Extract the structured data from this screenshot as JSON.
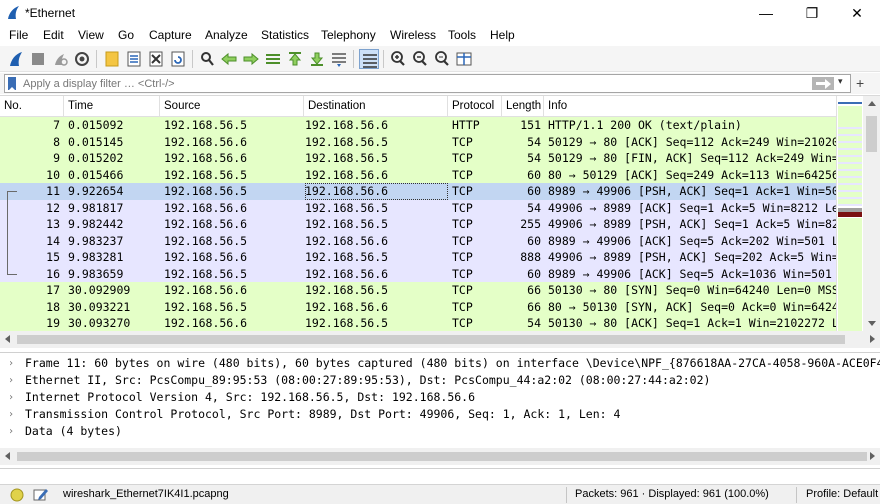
{
  "window": {
    "title": "*Ethernet",
    "minimize": "—",
    "maximize": "❐",
    "close": "✕"
  },
  "menu": [
    "File",
    "Edit",
    "View",
    "Go",
    "Capture",
    "Analyze",
    "Statistics",
    "Telephony",
    "Wireless",
    "Tools",
    "Help"
  ],
  "toolbar_icons": [
    "shark-fin-start-icon",
    "stop-icon",
    "restart-icon",
    "options-gear-icon",
    "open-file-icon",
    "save-file-icon",
    "close-file-icon",
    "reload-icon",
    "find-packet-icon",
    "go-back-icon",
    "go-forward-icon",
    "go-to-packet-icon",
    "go-first-icon",
    "go-last-icon",
    "autoscroll-icon",
    "colorize-icon",
    "zoom-in-icon",
    "zoom-out-icon",
    "zoom-normal-icon",
    "resize-columns-icon"
  ],
  "filter": {
    "placeholder": "Apply a display filter … <Ctrl-/>",
    "dropdown": "▾",
    "add": "+"
  },
  "columns": [
    "No.",
    "Time",
    "Source",
    "Destination",
    "Protocol",
    "Length",
    "Info"
  ],
  "packets": [
    {
      "no": "7",
      "time": "0.015092",
      "src": "192.168.56.5",
      "dst": "192.168.56.6",
      "proto": "HTTP",
      "len": "151",
      "info": "HTTP/1.1 200 OK  (text/plain)",
      "style": "http"
    },
    {
      "no": "8",
      "time": "0.015145",
      "src": "192.168.56.6",
      "dst": "192.168.56.5",
      "proto": "TCP",
      "len": "54",
      "info": "50129 → 80 [ACK] Seq=112 Ack=249 Win=21020",
      "style": "http"
    },
    {
      "no": "9",
      "time": "0.015202",
      "src": "192.168.56.6",
      "dst": "192.168.56.5",
      "proto": "TCP",
      "len": "54",
      "info": "50129 → 80 [FIN, ACK] Seq=112 Ack=249 Win=",
      "style": "http"
    },
    {
      "no": "10",
      "time": "0.015466",
      "src": "192.168.56.5",
      "dst": "192.168.56.6",
      "proto": "TCP",
      "len": "60",
      "info": "80 → 50129 [ACK] Seq=249 Ack=113 Win=64256",
      "style": "http"
    },
    {
      "no": "11",
      "time": "9.922654",
      "src": "192.168.56.5",
      "dst": "192.168.56.6",
      "proto": "TCP",
      "len": "60",
      "info": "8989 → 49906 [PSH, ACK] Seq=1 Ack=1 Win=50",
      "style": "selected"
    },
    {
      "no": "12",
      "time": "9.981817",
      "src": "192.168.56.6",
      "dst": "192.168.56.5",
      "proto": "TCP",
      "len": "54",
      "info": "49906 → 8989 [ACK] Seq=1 Ack=5 Win=8212 Le",
      "style": "tcp"
    },
    {
      "no": "13",
      "time": "9.982442",
      "src": "192.168.56.6",
      "dst": "192.168.56.5",
      "proto": "TCP",
      "len": "255",
      "info": "49906 → 8989 [PSH, ACK] Seq=1 Ack=5 Win=82",
      "style": "tcp"
    },
    {
      "no": "14",
      "time": "9.983237",
      "src": "192.168.56.5",
      "dst": "192.168.56.6",
      "proto": "TCP",
      "len": "60",
      "info": "8989 → 49906 [ACK] Seq=5 Ack=202 Win=501 L",
      "style": "tcp"
    },
    {
      "no": "15",
      "time": "9.983281",
      "src": "192.168.56.6",
      "dst": "192.168.56.5",
      "proto": "TCP",
      "len": "888",
      "info": "49906 → 8989 [PSH, ACK] Seq=202 Ack=5 Win=",
      "style": "tcp"
    },
    {
      "no": "16",
      "time": "9.983659",
      "src": "192.168.56.5",
      "dst": "192.168.56.6",
      "proto": "TCP",
      "len": "60",
      "info": "8989 → 49906 [ACK] Seq=5 Ack=1036 Win=501",
      "style": "tcp"
    },
    {
      "no": "17",
      "time": "30.092909",
      "src": "192.168.56.6",
      "dst": "192.168.56.5",
      "proto": "TCP",
      "len": "66",
      "info": "50130 → 80 [SYN] Seq=0 Win=64240 Len=0 MSS",
      "style": "http"
    },
    {
      "no": "18",
      "time": "30.093221",
      "src": "192.168.56.5",
      "dst": "192.168.56.6",
      "proto": "TCP",
      "len": "66",
      "info": "80 → 50130 [SYN, ACK] Seq=0 Ack=0 Win=6424",
      "style": "http"
    },
    {
      "no": "19",
      "time": "30.093270",
      "src": "192.168.56.6",
      "dst": "192.168.56.5",
      "proto": "TCP",
      "len": "54",
      "info": "50130 → 80 [ACK] Seq=1 Ack=1 Win=2102272 L",
      "style": "http"
    }
  ],
  "details": [
    "Frame 11: 60 bytes on wire (480 bits), 60 bytes captured (480 bits) on interface \\Device\\NPF_{876618AA-27CA-4058-960A-ACE0F42",
    "Ethernet II, Src: PcsCompu_89:95:53 (08:00:27:89:95:53), Dst: PcsCompu_44:a2:02 (08:00:27:44:a2:02)",
    "Internet Protocol Version 4, Src: 192.168.56.5, Dst: 192.168.56.6",
    "Transmission Control Protocol, Src Port: 8989, Dst Port: 49906, Seq: 1, Ack: 1, Len: 4",
    "Data (4 bytes)"
  ],
  "status": {
    "file": "wireshark_Ethernet7IK4I1.pcapng",
    "packets": "Packets: 961 · Displayed: 961 (100.0%)",
    "profile": "Profile: Default"
  },
  "colors": {
    "http_row": "#e4ffc7",
    "tcp_row": "#e7e6ff",
    "selected_row": "#c2d6f2",
    "accent": "#3a6db5"
  }
}
